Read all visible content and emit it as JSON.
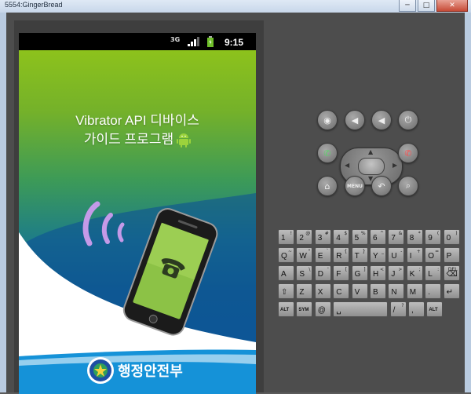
{
  "window": {
    "title": "5554:GingerBread",
    "min": "─",
    "max": "□",
    "close": "✕"
  },
  "statusbar": {
    "network": "3G",
    "time": "9:15"
  },
  "app": {
    "title_line1": "Vibrator API 디바이스",
    "title_line2": "가이드 프로그램",
    "brand": "행정안전부"
  },
  "controls": {
    "camera": "◉",
    "vol_down": "◀",
    "vol_up": "◀",
    "power": "⏻",
    "call": "✆",
    "end": "✆",
    "home": "⌂",
    "menu": "MENU",
    "back": "↶",
    "search": "⌕"
  },
  "keyboard": {
    "rows": [
      [
        {
          "m": "1",
          "a": "!"
        },
        {
          "m": "2",
          "a": "@"
        },
        {
          "m": "3",
          "a": "#"
        },
        {
          "m": "4",
          "a": "$"
        },
        {
          "m": "5",
          "a": "%"
        },
        {
          "m": "6",
          "a": "^"
        },
        {
          "m": "7",
          "a": "&"
        },
        {
          "m": "8",
          "a": "*"
        },
        {
          "m": "9",
          "a": "("
        },
        {
          "m": "0",
          "a": ")"
        }
      ],
      [
        {
          "m": "Q",
          "a": "~"
        },
        {
          "m": "W",
          "a": "\""
        },
        {
          "m": "E",
          "a": "`"
        },
        {
          "m": "R",
          "a": "{"
        },
        {
          "m": "T",
          "a": "}"
        },
        {
          "m": "Y",
          "a": "_"
        },
        {
          "m": "U",
          "a": "-"
        },
        {
          "m": "I",
          "a": "+"
        },
        {
          "m": "O",
          "a": "="
        },
        {
          "m": "P",
          "a": ""
        }
      ],
      [
        {
          "m": "A",
          "a": ""
        },
        {
          "m": "S",
          "a": "\\"
        },
        {
          "m": "D",
          "a": "'"
        },
        {
          "m": "F",
          "a": "["
        },
        {
          "m": "G",
          "a": "]"
        },
        {
          "m": "H",
          "a": "<"
        },
        {
          "m": "J",
          "a": ">"
        },
        {
          "m": "K",
          "a": ";"
        },
        {
          "m": "L",
          "a": ":"
        },
        {
          "m": "⌫",
          "a": "DEL"
        }
      ],
      [
        {
          "m": "⇧",
          "a": ""
        },
        {
          "m": "Z",
          "a": ""
        },
        {
          "m": "X",
          "a": ""
        },
        {
          "m": "C",
          "a": ""
        },
        {
          "m": "V",
          "a": ""
        },
        {
          "m": "B",
          "a": ""
        },
        {
          "m": "N",
          "a": ""
        },
        {
          "m": "M",
          "a": ""
        },
        {
          "m": ".",
          "a": ""
        },
        {
          "m": "↵",
          "a": ""
        }
      ],
      [
        {
          "m": "ALT",
          "a": ""
        },
        {
          "m": "SYM",
          "a": ""
        },
        {
          "m": "@",
          "a": ""
        },
        {
          "m": "␣",
          "a": ""
        },
        {
          "m": "/",
          "a": "?"
        },
        {
          "m": ",",
          "a": ""
        },
        {
          "m": "ALT",
          "a": ""
        }
      ]
    ]
  }
}
